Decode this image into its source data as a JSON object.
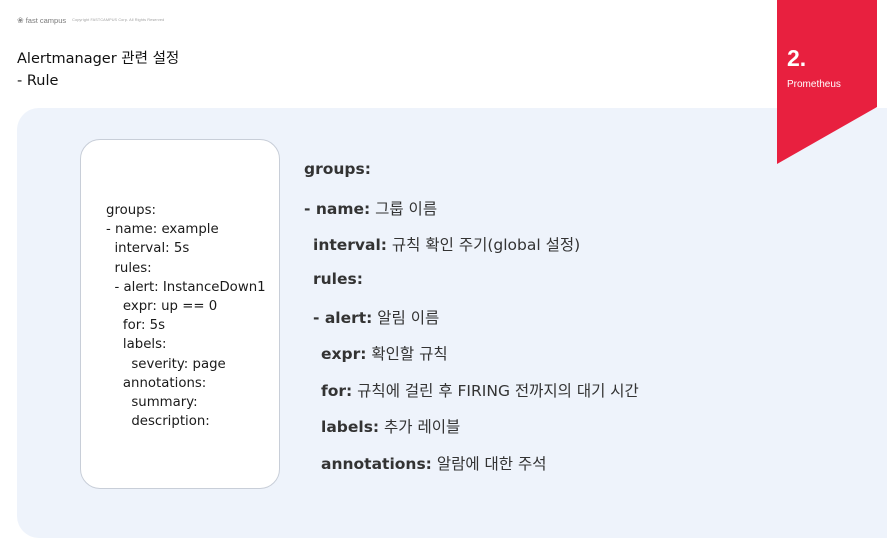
{
  "brand": {
    "logo_text": "fast campus",
    "copyright": "Copyright FASTCAMPUS Corp. All Rights Reserved"
  },
  "title": {
    "line1": "Alertmanager 관련 설정",
    "line2": "- Rule"
  },
  "section": {
    "number": "2.",
    "name": "Prometheus",
    "color": "#e8203f"
  },
  "code_lines": [
    "groups:",
    "- name: example",
    "  interval: 5s",
    "  rules:",
    "  - alert: InstanceDown1",
    "    expr: up == 0",
    "    for: 5s",
    "    labels:",
    "      severity: page",
    "    annotations:",
    "      summary:",
    "      description:"
  ],
  "explanations": [
    {
      "key": "groups:",
      "desc": ""
    },
    {
      "key": "- name:",
      "desc": " 그룹 이름"
    },
    {
      "key": "interval:",
      "desc": " 규칙 확인 주기(global 설정)"
    },
    {
      "key": "rules:",
      "desc": ""
    },
    {
      "key": "- alert:",
      "desc": " 알림 이름"
    },
    {
      "key": "expr:",
      "desc": " 확인할 규칙"
    },
    {
      "key": "for:",
      "desc": " 규칙에 걸린 후 FIRING 전까지의 대기 시간"
    },
    {
      "key": "labels:",
      "desc": " 추가 레이블"
    },
    {
      "key": "annotations:",
      "desc": " 알람에 대한 주석"
    }
  ],
  "colors": {
    "panel_bg": "#eef3fb",
    "accent": "#e8203f"
  }
}
